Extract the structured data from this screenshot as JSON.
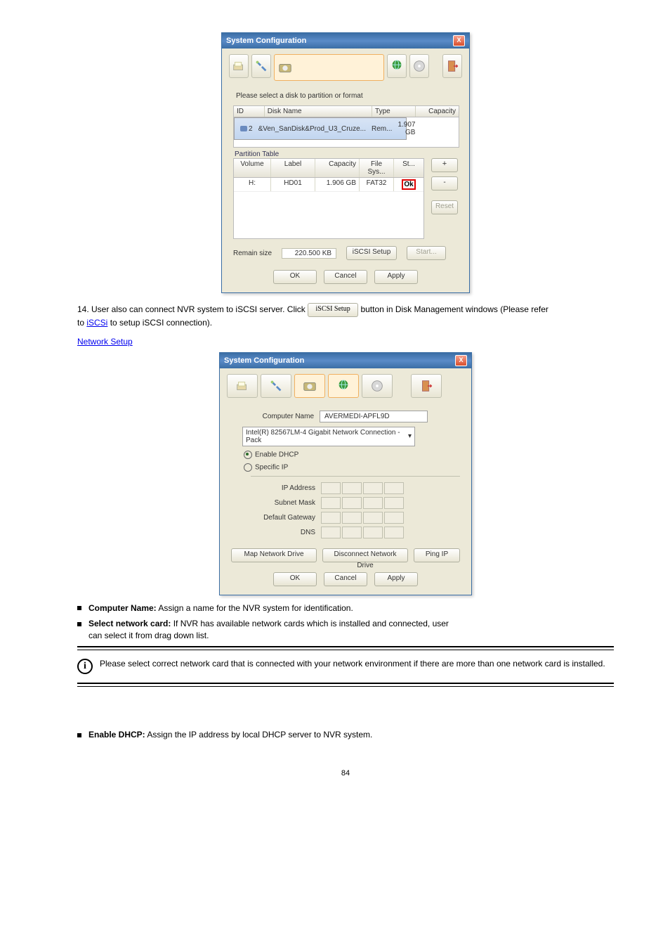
{
  "page_number": "84",
  "dialog1": {
    "title": "System Configuration",
    "close": "X",
    "instruction": "Please select a disk to partition or format",
    "disktable": {
      "headers": [
        "ID",
        "Disk Name",
        "Type",
        "Capacity"
      ],
      "row": {
        "id": "2",
        "name": "&Ven_SanDisk&Prod_U3_Cruze...",
        "type": "Rem...",
        "cap": "1.907 GB"
      }
    },
    "pt_label": "Partition Table",
    "pt_headers": [
      "Volume",
      "Label",
      "Capacity",
      "File Sys...",
      "St..."
    ],
    "pt_row": {
      "vol": "H:",
      "label": "HD01",
      "cap": "1.906 GB",
      "fs": "FAT32",
      "st": "Ok"
    },
    "btn_plus": "+",
    "btn_minus": "-",
    "btn_reset": "Reset",
    "remain_label": "Remain size",
    "remain_value": "220.500 KB",
    "btn_iscsi": "iSCSI Setup",
    "btn_start": "Start...",
    "btn_ok": "OK",
    "btn_cancel": "Cancel",
    "btn_apply": "Apply"
  },
  "step14_a": "14. User also can connect NVR system to iSCSI server. Click ",
  "step14_b": " button in Disk Management windows (Please refer",
  "step14_c": "to ",
  "step14_d": "iSCSi",
  "step14_e": " to setup iSCSI connection).",
  "section_link": "Network Setup",
  "dialog2": {
    "title": "System Configuration",
    "close": "X",
    "cn_label": "Computer Name",
    "cn_value": "AVERMEDI-APFL9D",
    "nic_value": "Intel(R) 82567LM-4 Gigabit Network Connection - Pack",
    "dhcp_label": "Enable DHCP",
    "spec_label": "Specific IP",
    "ip_label": "IP Address",
    "subnet_label": "Subnet Mask",
    "gw_label": "Default Gateway",
    "dns_label": "DNS",
    "btn_map": "Map Network Drive",
    "btn_disc": "Disconnect Network Drive",
    "btn_ping": "Ping IP"
  },
  "bul1_a": "Computer Name:",
  "bul1_b": " Assign a name for the NVR system for identification.",
  "bul2_a": "Select network card:",
  "bul2_b": " If NVR has available network cards which is installed and connected, user",
  "bul2_c": "can select it from drag down list.",
  "note": "Please select correct network card that is connected with your network environment if there are more than one network card is installed.",
  "bul3_a": "Enable DHCP:",
  "bul3_b": " Assign the IP address by local DHCP server to NVR system."
}
